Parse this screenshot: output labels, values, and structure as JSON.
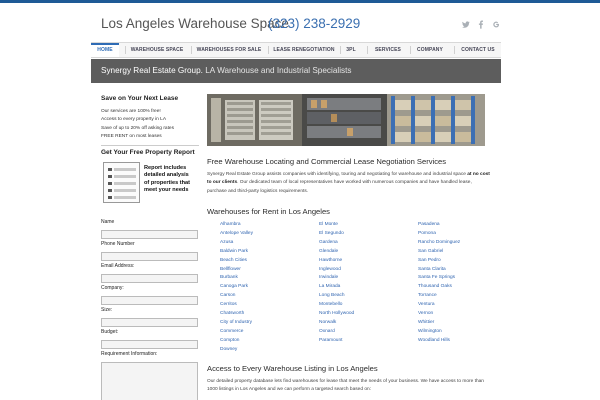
{
  "header": {
    "site_title": "Los Angeles Warehouse Space",
    "phone": "(323) 238-2929",
    "social": [
      "twitter-icon",
      "facebook-icon",
      "google-plus-icon"
    ]
  },
  "nav": {
    "items": [
      {
        "label": "HOME",
        "active": true
      },
      {
        "label": "WAREHOUSE SPACE"
      },
      {
        "label": "WAREHOUSES FOR SALE"
      },
      {
        "label": "LEASE RENEGOTIATION"
      },
      {
        "label": "3PL"
      },
      {
        "label": "SERVICES"
      },
      {
        "label": "COMPANY"
      },
      {
        "label": "CONTACT US"
      }
    ]
  },
  "banner": {
    "company": "Synergy Real Estate Group.",
    "tagline": " LA Warehouse and Industrial Specialists"
  },
  "sidebar": {
    "lease_heading": "Save on Your Next Lease",
    "lease_points": [
      "Our services are 100% free!",
      "Access to every property in LA",
      "Save of up to 20% off asking rates",
      "FREE RENT on most leases"
    ],
    "report_heading": "Get Your Free Property Report",
    "report_text": "Report includes detailed analysis of properties that meet your needs",
    "form": {
      "name_label": "Name",
      "phone_label": "Phone Number",
      "email_label": "Email Address:",
      "company_label": "Company:",
      "size_label": "Size:",
      "budget_label": "Budget:",
      "requirement_label": "Requirement Information:"
    }
  },
  "main": {
    "intro_heading": "Free Warehouse Locating and Commercial Lease Negotiation Services",
    "intro_text_a": "Synergy Real Estate Group assists companies with identifying, touring and negotiating for warehouse and industrial space ",
    "intro_text_bold": "at no cost to our clients",
    "intro_text_b": ". Our dedicated team of local representatives have worked with numerous companies and have handled lease, purchase and third-party logistics requirements.",
    "rent_heading": "Warehouses for Rent in Los Angeles",
    "cities_col1": [
      "Alhambra",
      "Antelope Valley",
      "Azusa",
      "Baldwin Park",
      "Beach Cities",
      "Bellflower",
      "Burbank",
      "Canoga Park",
      "Carson",
      "Cerritos",
      "Chatsworth",
      "City of Industry",
      "Commerce",
      "Compton",
      "Downey"
    ],
    "cities_col2": [
      "El Monte",
      "El Segundo",
      "Gardena",
      "Glendale",
      "Hawthorne",
      "Inglewood",
      "Irwindale",
      "La Mirada",
      "Long Beach",
      "Montebello",
      "North Hollywood",
      "Norwalk",
      "Oxnard",
      "Paramount"
    ],
    "cities_col3": [
      "Pasadena",
      "Pomona",
      "Rancho Dominguez",
      "San Gabriel",
      "San Pedro",
      "Santa Clarita",
      "Santa Fe Springs",
      "Thousand Oaks",
      "Torrance",
      "Ventura",
      "Vernon",
      "Whittier",
      "Wilmington",
      "Woodland Hills"
    ],
    "access_heading": "Access to Every Warehouse Listing in Los Angeles",
    "access_text": "Our detailed property database lets find warehouses for lease that meet the needs of your business. We have access to more than 1000 listings in Los Angeles and we can perform a targeted search based on:"
  },
  "colors": {
    "accent": "#2e6bb5",
    "banner_bg": "#5d5d5d",
    "link": "#2f64b0"
  }
}
